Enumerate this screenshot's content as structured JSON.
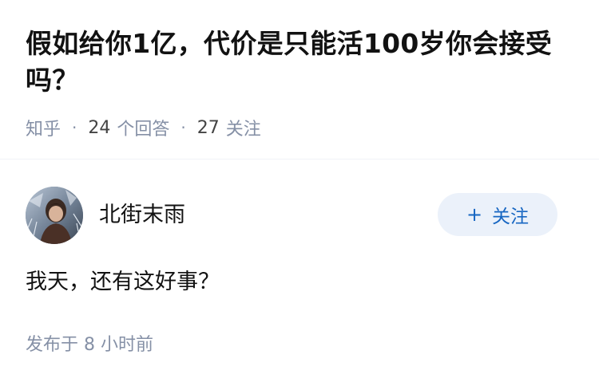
{
  "question": {
    "title": "假如给你1亿，代价是只能活100岁你会接受吗？",
    "source": "知乎",
    "answer_count": "24",
    "answer_label": "个回答",
    "follower_count": "27",
    "follower_label": "关注"
  },
  "answer": {
    "author": {
      "name": "北街末雨",
      "avatar_icon": "user-avatar"
    },
    "follow_button": {
      "plus": "+",
      "label": "关注"
    },
    "content": "我天，还有这好事？",
    "published_prefix": "发布于",
    "published_value": "8 小时前"
  },
  "colors": {
    "text_primary": "#121212",
    "text_secondary": "#8590a6",
    "button_bg": "#ebf1fa",
    "button_text": "#1766c2"
  }
}
